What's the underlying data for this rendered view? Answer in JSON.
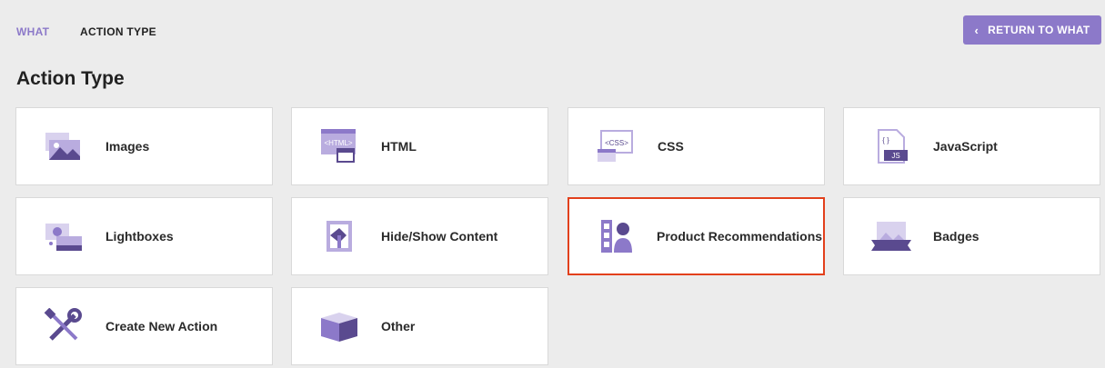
{
  "breadcrumb": {
    "link": "WHAT",
    "current": "ACTION TYPE"
  },
  "return_button": {
    "label": "RETURN TO WHAT",
    "icon": "chevron-left-icon"
  },
  "page_title": "Action Type",
  "colors": {
    "accent": "#8c79c9",
    "selected_border": "#e2401c",
    "icon_dark": "#5a4a8f"
  },
  "cards": [
    {
      "label": "Images",
      "icon": "images-icon",
      "selected": false
    },
    {
      "label": "HTML",
      "icon": "html-icon",
      "selected": false
    },
    {
      "label": "CSS",
      "icon": "css-icon",
      "selected": false
    },
    {
      "label": "JavaScript",
      "icon": "javascript-icon",
      "selected": false
    },
    {
      "label": "Lightboxes",
      "icon": "lightboxes-icon",
      "selected": false
    },
    {
      "label": "Hide/Show Content",
      "icon": "hide-show-icon",
      "selected": false
    },
    {
      "label": "Product Recommendations",
      "icon": "product-recommendations-icon",
      "selected": true
    },
    {
      "label": "Badges",
      "icon": "badges-icon",
      "selected": false
    },
    {
      "label": "Create New Action",
      "icon": "tools-icon",
      "selected": false
    },
    {
      "label": "Other",
      "icon": "box-icon",
      "selected": false
    }
  ],
  "icon_text": {
    "html": "<HTML>",
    "css": "<CSS>",
    "js_braces": "{ }",
    "js": "JS"
  }
}
